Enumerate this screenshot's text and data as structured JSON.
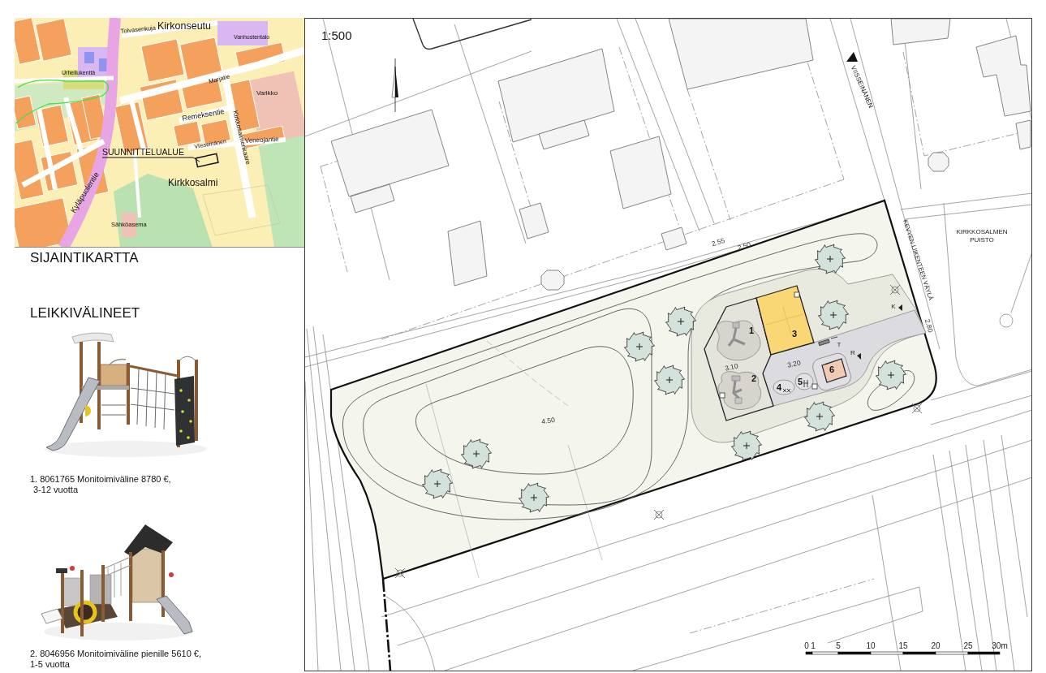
{
  "location_map": {
    "labels": [
      "Kirkonseutu",
      "Kirkkosalmi",
      "Tolvasenkuja",
      "Marjatie",
      "Remeksentie",
      "Viisseinänen",
      "Veneojantie",
      "Kirkkosalmenkaare",
      "Kyläpuolentie",
      "Urheilukenttä",
      "Sähköasema",
      "Vanhustentalo",
      "Varikko"
    ],
    "callout": "SUUNNITTELUALUE"
  },
  "location_map_title": "SIJAINTIKARTTA",
  "equipment_section": {
    "heading": "LEIKKIVÄLINEET",
    "items": [
      {
        "kind": "tower",
        "title": "1. 8061765 Monitoimiväline 8780 €,",
        "age": "3-12 vuotta"
      },
      {
        "kind": "house",
        "title": "2. 8046956 Monitoimiväline pienille 5610 €,",
        "age": "1-5 vuotta"
      }
    ]
  },
  "plan": {
    "scale": "1:500",
    "street": "VIISSEINÄNEN",
    "pathway": "KEVYEN LIIKENTEEN VÄYLÄ",
    "park_name": [
      "KIRKKOSALMEN",
      "PUISTO"
    ],
    "elevations": [
      "2.55",
      "2.50",
      "2.80",
      "3.10",
      "3.20",
      "4.50"
    ],
    "zone_numbers": [
      "1",
      "2",
      "3",
      "4",
      "5",
      "6"
    ],
    "symbol_letters": [
      "K",
      "T",
      "R"
    ],
    "scale_bar": [
      "0",
      "1",
      "5",
      "10",
      "15",
      "20",
      "25",
      "30m"
    ]
  }
}
